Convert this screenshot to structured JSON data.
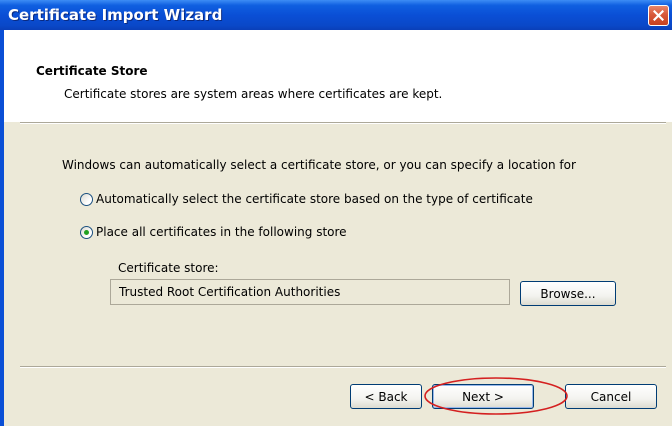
{
  "window": {
    "title": "Certificate Import Wizard"
  },
  "header": {
    "title": "Certificate Store",
    "description": "Certificate stores are system areas where certificates are kept."
  },
  "body": {
    "intro": "Windows can automatically select a certificate store, or you can specify a location for",
    "options": [
      {
        "label": "Automatically select the certificate store based on the type of certificate",
        "selected": false
      },
      {
        "label": "Place all certificates in the following store",
        "selected": true
      }
    ],
    "store_label": "Certificate store:",
    "store_value": "Trusted Root Certification Authorities",
    "browse_label": "Browse..."
  },
  "footer": {
    "back_label": "< Back",
    "next_label": "Next >",
    "cancel_label": "Cancel"
  },
  "annotation": {
    "ellipse_color": "#d42020"
  },
  "colors": {
    "titlebar": "#0a4fd6",
    "dialog_bg": "#ece9d8",
    "close_button": "#d8593b",
    "radio_dot": "#21a121"
  },
  "icons": {
    "close": "close-icon"
  }
}
